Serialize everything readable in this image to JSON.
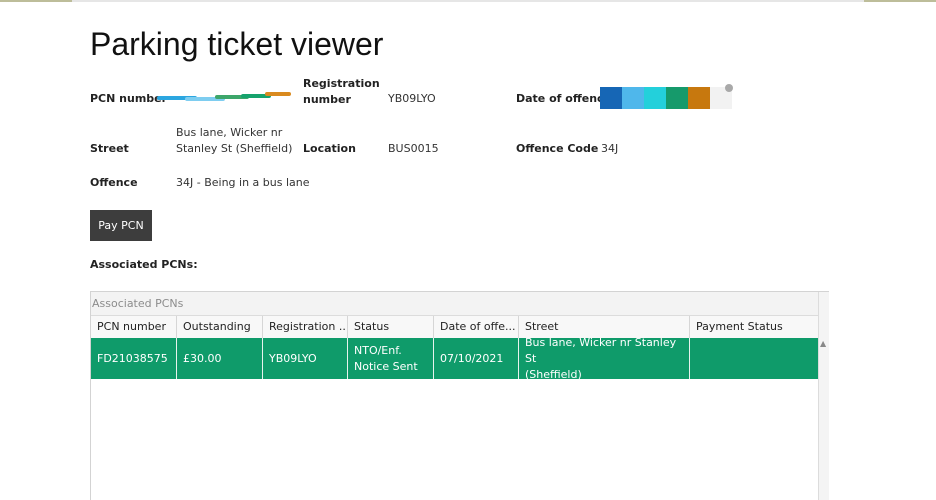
{
  "page": {
    "title": "Parking ticket viewer"
  },
  "details": {
    "pcn_number_label": "PCN number",
    "registration_label": "Registration\nnumber",
    "registration_value": "YB09LYO",
    "date_of_offence_label": "Date of offence",
    "street_label": "Street",
    "street_value_line1": "Bus lane, Wicker nr",
    "street_value_line2": "Stanley St (Sheffield)",
    "location_label": "Location",
    "location_value": "BUS0015",
    "offence_code_label": "Offence Code",
    "offence_code_value": "34J",
    "offence_label": "Offence",
    "offence_value": "34J - Being in a bus lane"
  },
  "redaction": {
    "pcn_colors": [
      "#2ba6e0",
      "#7ecdf0",
      "#3da66a",
      "#16a36d",
      "#d98a1f"
    ],
    "date_colors": [
      "#1666b5",
      "#4fb7eb",
      "#23d0db",
      "#169a6b",
      "#c7780e",
      "#f2f2f2"
    ]
  },
  "actions": {
    "pay_label": "Pay PCN"
  },
  "associated": {
    "section_label": "Associated PCNs:",
    "grid_title": "Associated PCNs",
    "columns": [
      "PCN number",
      "Outstanding",
      "Registration ...",
      "Status",
      "Date of offe...",
      "Street",
      "Payment Status"
    ],
    "rows": [
      {
        "pcn": "FD21038575",
        "outstanding": "£30.00",
        "registration": "YB09LYO",
        "status_line1": "NTO/Enf.",
        "status_line2": "Notice Sent",
        "date": "07/10/2021",
        "street_line1": "Bus lane, Wicker nr Stanley St",
        "street_line2": "(Sheffield)",
        "payment_status": ""
      }
    ]
  },
  "colors": {
    "selected_row": "#0f9b6a",
    "button": "#3d3d3d"
  }
}
